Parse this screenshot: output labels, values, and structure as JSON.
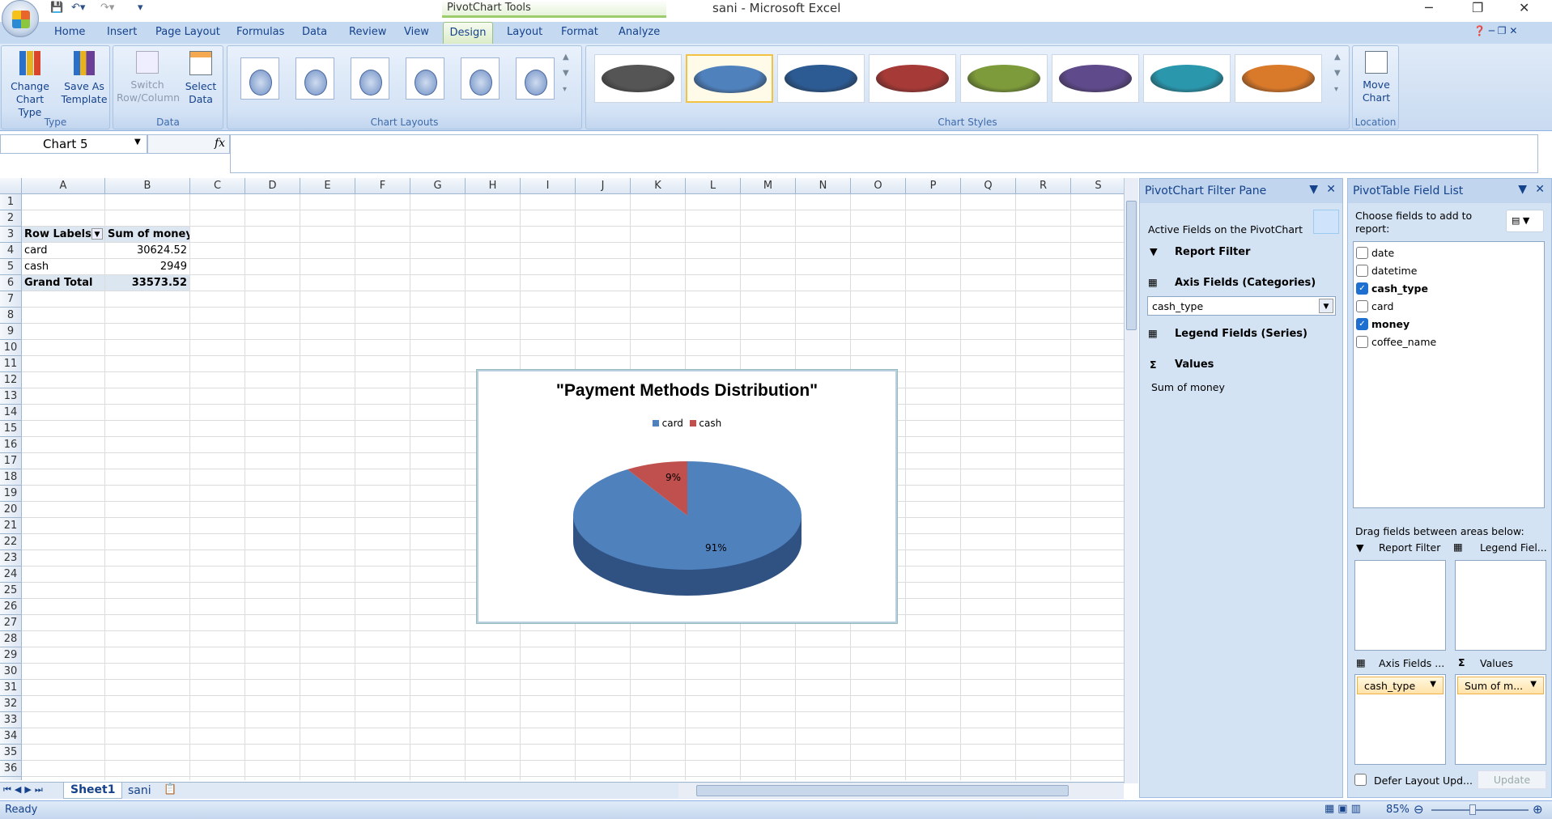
{
  "window": {
    "title": "sani - Microsoft Excel",
    "contextual_tab_group": "PivotChart Tools",
    "controls": [
      "─",
      "❐",
      "✕"
    ]
  },
  "ribbon_tabs": [
    "Home",
    "Insert",
    "Page Layout",
    "Formulas",
    "Data",
    "Review",
    "View",
    "Design",
    "Layout",
    "Format",
    "Analyze"
  ],
  "active_tab": "Design",
  "ribbon": {
    "type_group": {
      "label": "Type",
      "buttons": [
        {
          "line1": "Change",
          "line2": "Chart Type"
        },
        {
          "line1": "Save As",
          "line2": "Template"
        }
      ]
    },
    "data_group": {
      "label": "Data",
      "buttons": [
        {
          "line1": "Switch",
          "line2": "Row/Column"
        },
        {
          "line1": "Select",
          "line2": "Data"
        }
      ]
    },
    "layouts_group": {
      "label": "Chart Layouts"
    },
    "styles_group": {
      "label": "Chart Styles",
      "style_colors": [
        "#555555",
        "#4f81bd",
        "#2c5b94",
        "#a63a37",
        "#7d9b3a",
        "#5f4a8b",
        "#2a97ad",
        "#d9792a"
      ],
      "selected_index": 1
    },
    "location_group": {
      "label": "Location",
      "button": {
        "line1": "Move",
        "line2": "Chart"
      }
    }
  },
  "formula_bar": {
    "name_box": "Chart 5",
    "fx": "fx",
    "value": ""
  },
  "sheet": {
    "columns": [
      "A",
      "B",
      "C",
      "D",
      "E",
      "F",
      "G",
      "H",
      "I",
      "J",
      "K",
      "L",
      "M",
      "N",
      "O",
      "P",
      "Q",
      "R",
      "S"
    ],
    "row_count": 36,
    "cells": {
      "A3": "Row Labels",
      "B3": "Sum of money",
      "A4": "card",
      "B4": "30624.52",
      "A5": "cash",
      "B5": "2949",
      "A6": "Grand Total",
      "B6": "33573.52"
    },
    "tabs": [
      "Sheet1",
      "sani"
    ],
    "active_tab": "Sheet1"
  },
  "chart_data": {
    "type": "pie",
    "title": "\"Payment Methods Distribution\"",
    "categories": [
      "card",
      "cash"
    ],
    "values": [
      30624.52,
      2949
    ],
    "data_labels": [
      "91%",
      "9%"
    ],
    "colors": [
      "#4f81bd",
      "#c0504d"
    ],
    "legend_placement": "top"
  },
  "filter_pane": {
    "title": "PivotChart Filter Pane",
    "active_fields": "Active Fields on the PivotChart",
    "report_filter": "Report Filter",
    "axis_fields": "Axis Fields (Categories)",
    "axis_value": "cash_type",
    "legend_fields": "Legend Fields (Series)",
    "values": "Values",
    "values_item": "Sum of money"
  },
  "field_list": {
    "title": "PivotTable Field List",
    "choose": "Choose fields to add to report:",
    "fields": [
      {
        "name": "date",
        "checked": false
      },
      {
        "name": "datetime",
        "checked": false
      },
      {
        "name": "cash_type",
        "checked": true
      },
      {
        "name": "card",
        "checked": false
      },
      {
        "name": "money",
        "checked": true
      },
      {
        "name": "coffee_name",
        "checked": false
      }
    ],
    "drag_label": "Drag fields between areas below:",
    "areas": {
      "report_filter": "Report Filter",
      "legend_fields": "Legend Fiel...",
      "axis_fields": "Axis Fields ...",
      "values": "Values"
    },
    "axis_item": "cash_type",
    "values_item": "Sum of m...",
    "defer": "Defer Layout Upd...",
    "update": "Update"
  },
  "status": {
    "text": "Ready",
    "zoom": "85%"
  }
}
